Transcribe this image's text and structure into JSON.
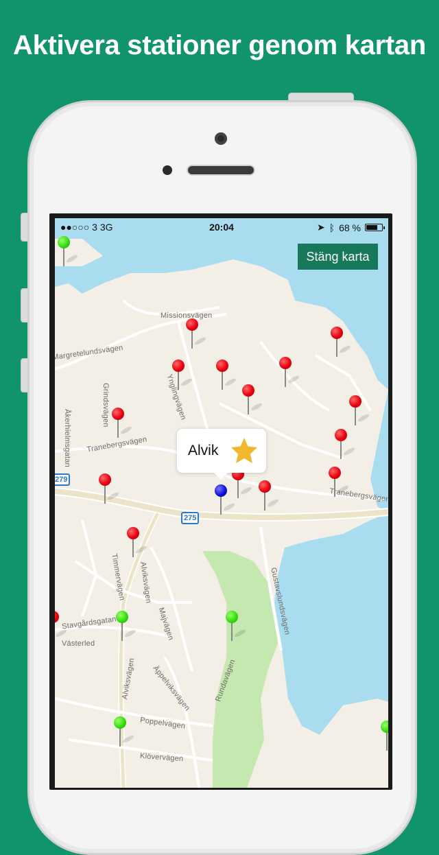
{
  "headline": "Aktivera stationer genom kartan",
  "status_bar": {
    "signal": "●●○○○ 3   3G",
    "time": "20:04",
    "battery_percent": "68 %",
    "battery_level": 0.68
  },
  "close_map_label": "Stäng karta",
  "callout": {
    "title": "Alvik",
    "icon": "star-icon",
    "star_color": "#f0b72f"
  },
  "road_badges": [
    "279",
    "275"
  ],
  "streets": [
    "Missionsvägen",
    "Margretelundsvägen",
    "Grindsvägen",
    "Åkerhielmsgatan",
    "Ynglingvägen",
    "Tranebergsvägen",
    "Tranebergsvägen",
    "Timmervägen",
    "Alviksvägen",
    "Gustavslundsvägen",
    "Stavgårdsgatan",
    "Västerled",
    "Majvägen",
    "Alviksvägen",
    "Äppelviksvägen",
    "Rundavägen",
    "Poppelvägen",
    "Klövervägen"
  ],
  "colors": {
    "background": "#11946b",
    "button": "#18785a",
    "water": "#aadcf0",
    "land": "#f3efe6",
    "park": "#c5e8b0",
    "pin_red": "#e8000f",
    "pin_green": "#35dd10",
    "pin_blue": "#1010e0"
  }
}
